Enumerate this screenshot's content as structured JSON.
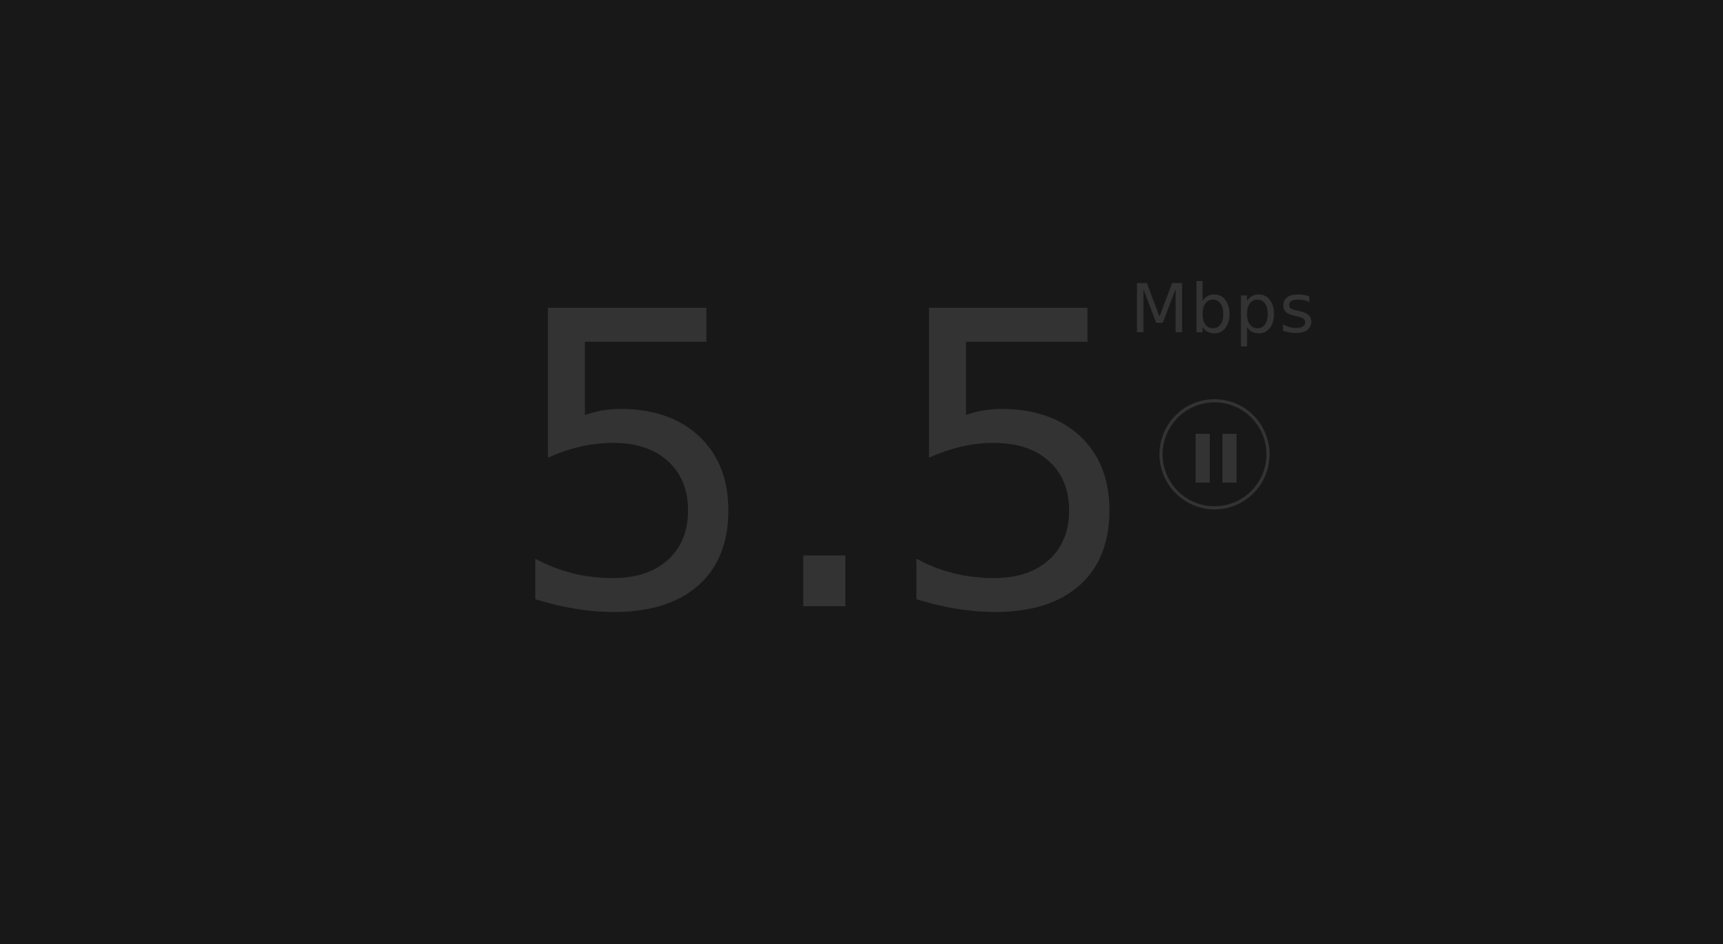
{
  "speed": {
    "value": "5.5",
    "unit": "Mbps"
  },
  "controls": {
    "pause_icon": "pause-icon"
  },
  "colors": {
    "background": "#181818",
    "foreground": "#333333"
  }
}
